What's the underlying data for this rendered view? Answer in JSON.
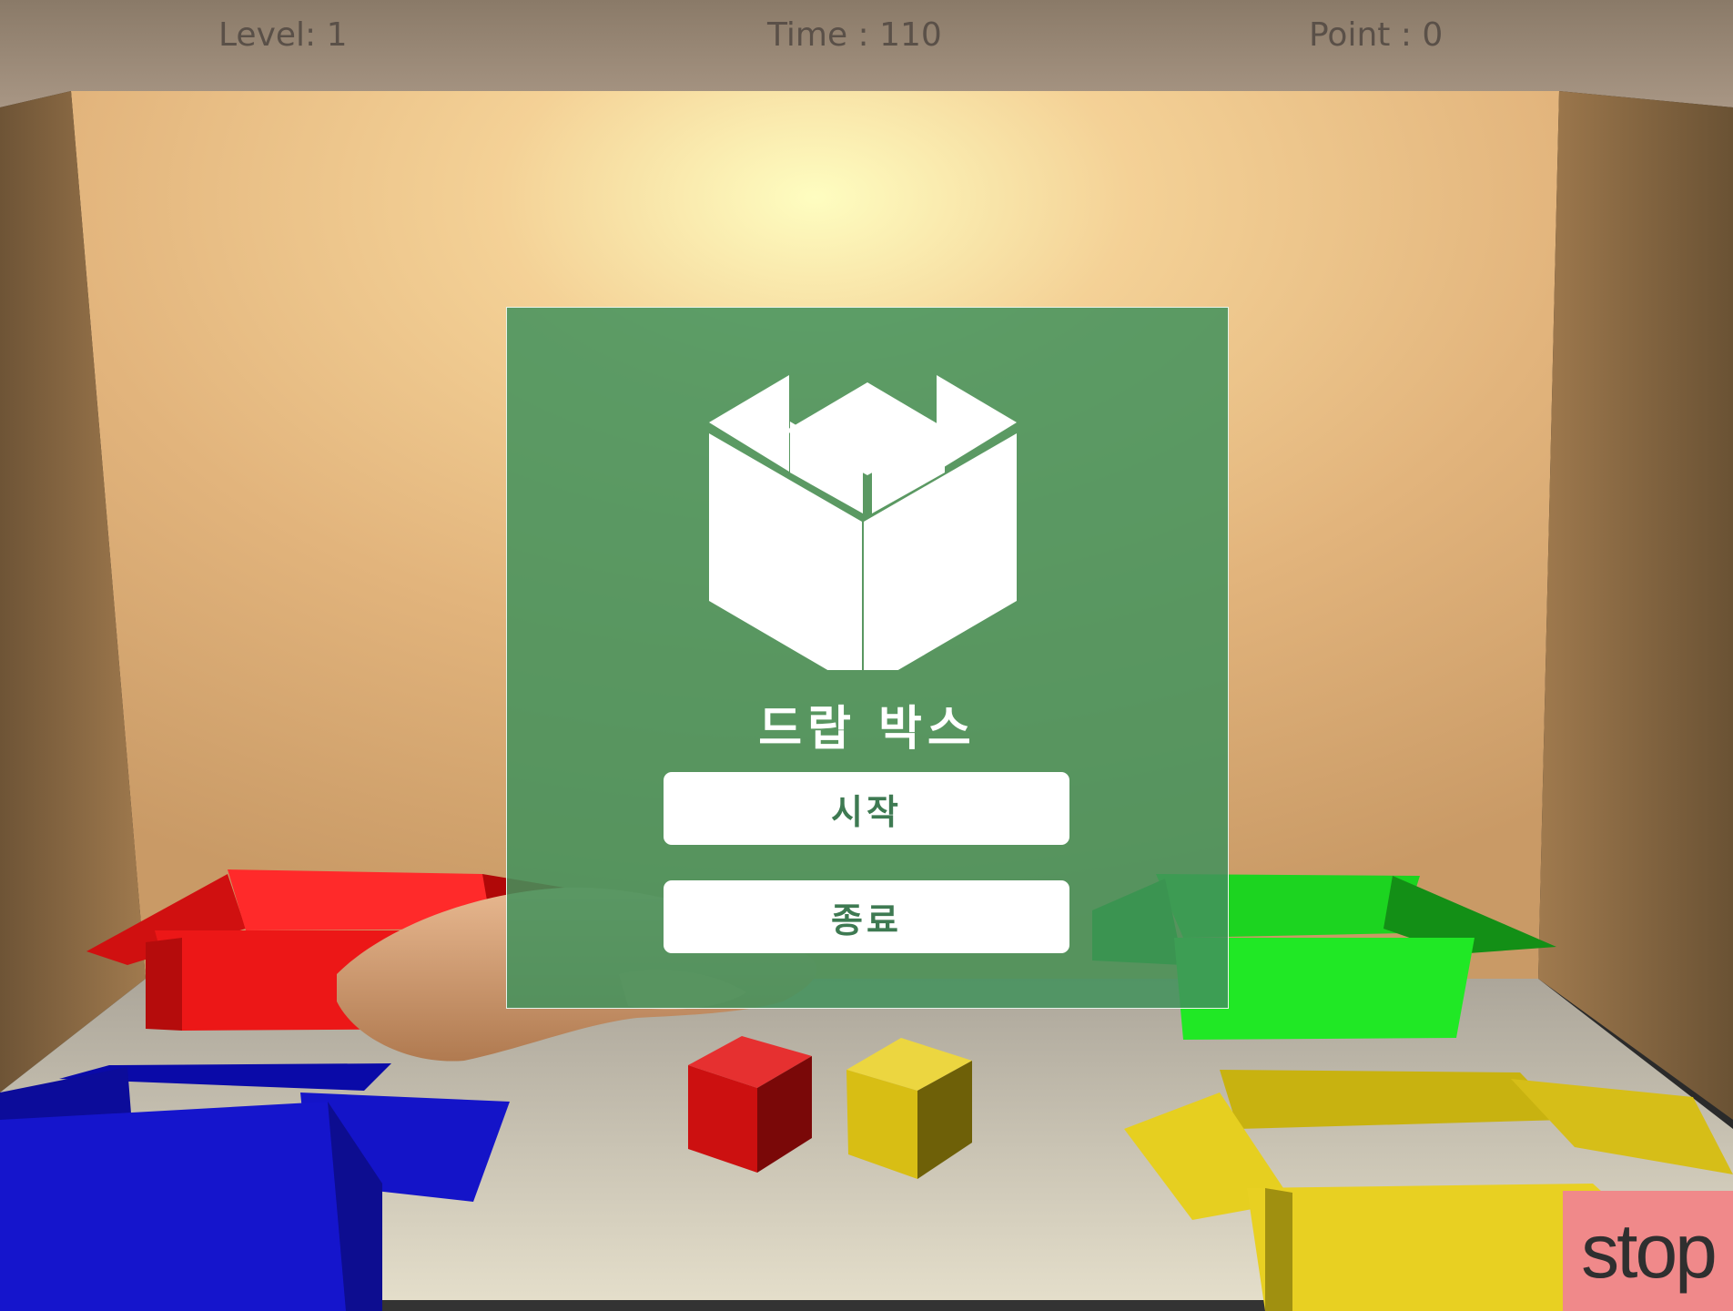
{
  "hud": {
    "level": "Level: 1",
    "time": "Time : 110",
    "point": "Point : 0"
  },
  "menu": {
    "title": "드랍 박스",
    "start_label": "시작",
    "exit_label": "종료",
    "logo_icon": "open-box-icon",
    "panel_color": "#42915c"
  },
  "controls": {
    "stop_label": "stop",
    "stop_color": "#f0898a"
  },
  "scene": {
    "boxes": [
      "red-box",
      "green-box",
      "blue-box",
      "yellow-box"
    ],
    "cubes": [
      "red-cube",
      "yellow-cube"
    ],
    "colors": {
      "red": "#e01515",
      "green": "#1fd624",
      "blue": "#1010c8",
      "yellow": "#e0c81a"
    }
  }
}
